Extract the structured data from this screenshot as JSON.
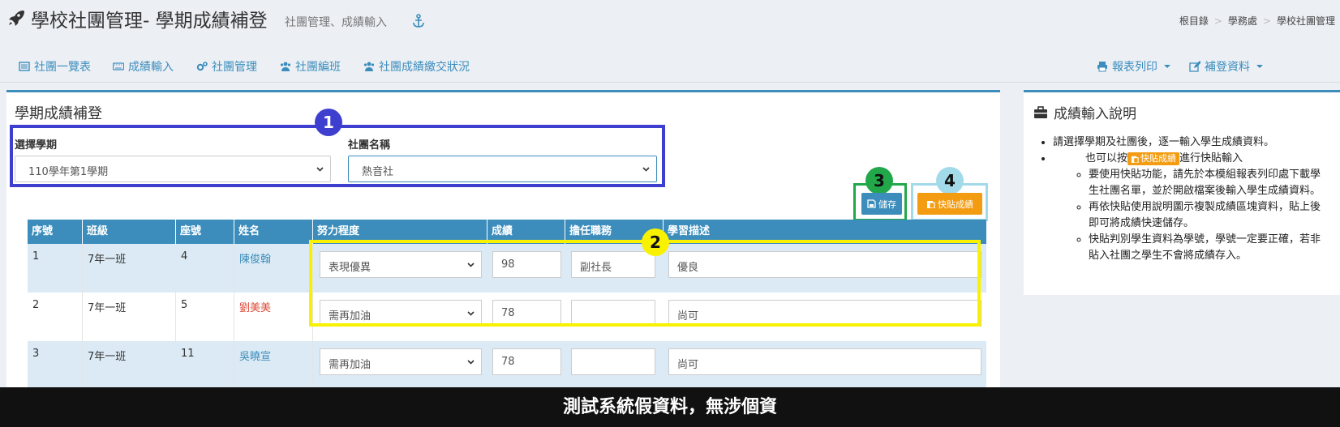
{
  "header": {
    "title": "學校社團管理- 學期成績補登",
    "subtitle": "社團管理、成績輸入",
    "breadcrumb": [
      "根目錄",
      "學務處",
      "學校社團管理"
    ]
  },
  "nav": {
    "left": [
      "社團一覽表",
      "成績輸入",
      "社團管理",
      "社團編班",
      "社團成績繳交狀況"
    ],
    "right": [
      "報表列印",
      "補登資料"
    ]
  },
  "main": {
    "title": "學期成績補登",
    "semester_label": "選擇學期",
    "semester_value": "110學年第1學期",
    "club_label": "社團名稱",
    "club_value": "熱音社",
    "save_label": "儲存",
    "paste_label": "快貼成績"
  },
  "badges": [
    "1",
    "2",
    "3",
    "4"
  ],
  "table": {
    "headers": [
      "序號",
      "班級",
      "座號",
      "姓名",
      "努力程度",
      "成績",
      "擔任職務",
      "學習描述"
    ],
    "rows": [
      {
        "no": "1",
        "class": "7年一班",
        "seat": "4",
        "name": "陳俊翰",
        "effort": "表現優異",
        "score": "98",
        "role": "副社長",
        "desc": "優良"
      },
      {
        "no": "2",
        "class": "7年一班",
        "seat": "5",
        "name": "劉美美",
        "effort": "需再加油",
        "score": "78",
        "role": "",
        "desc": "尚可"
      },
      {
        "no": "3",
        "class": "7年一班",
        "seat": "11",
        "name": "吳曉宣",
        "effort": "需再加油",
        "score": "78",
        "role": "",
        "desc": "尚可"
      }
    ]
  },
  "side": {
    "title": "成績輸入說明",
    "item1": "請選擇學期及社團後，逐一輸入學生成績資料。",
    "item2_pre": "也可以按",
    "item2_btn": "快貼成績",
    "item2_post": "進行快貼輸入",
    "sub1": "要使用快貼功能，請先於本模組報表列印處下載學生社團名單，並於開啟檔案後輸入學生成績資料。",
    "sub2": "再依快貼使用說明圖示複製成績區塊資料，貼上後即可將成績快速儲存。",
    "sub3": "快貼判別學生資料為學號，學號一定要正確，若非貼入社團之學生不會將成績存入。"
  },
  "banner": "測試系統假資料，無涉個資",
  "colors": {
    "accent": "#3c8dbc",
    "warning": "#f39c12",
    "annotation_blue": "#3f3fcf",
    "annotation_yellow": "#f8f200",
    "annotation_green": "#22a84a",
    "annotation_cyan": "#a3daea"
  },
  "icons": [
    "rocket-icon",
    "anchor-icon",
    "list-icon",
    "keyboard-icon",
    "cogs-icon",
    "users-icon",
    "print-icon",
    "edit-icon",
    "save-icon",
    "paste-icon",
    "briefcase-icon",
    "chevron-down-icon"
  ]
}
